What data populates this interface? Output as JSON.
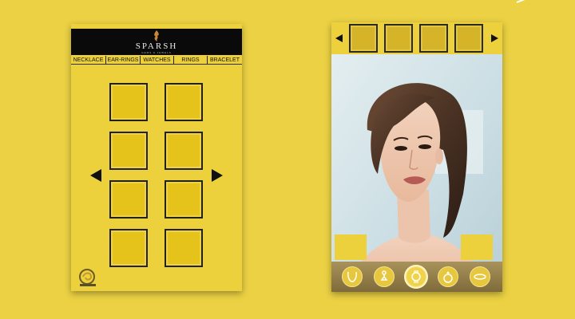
{
  "app": {
    "brand_name": "SPARSH",
    "brand_tagline": "GEMS & JEWELS",
    "brand_color": "#0a0a0a",
    "accent_color": "#ebd143"
  },
  "left_screen": {
    "categories": [
      {
        "label": "NECKLACE"
      },
      {
        "label": "EAR-RINGS"
      },
      {
        "label": "WATCHES"
      },
      {
        "label": "RINGS"
      },
      {
        "label": "BRACELET"
      }
    ],
    "grid_slot_count": 8,
    "prev_icon": "triangle-left-icon",
    "next_icon": "triangle-right-icon",
    "corner_logo_icon": "swirl-logo-icon"
  },
  "right_screen": {
    "thumbnail_count": 4,
    "prev_icon": "triangle-left-icon",
    "next_icon": "triangle-right-icon",
    "photo": "woman-portrait",
    "tools": [
      {
        "name": "necklace-icon",
        "active": false
      },
      {
        "name": "earring-icon",
        "active": false
      },
      {
        "name": "watch-icon",
        "active": true
      },
      {
        "name": "ring-icon",
        "active": false
      },
      {
        "name": "bracelet-icon",
        "active": false
      }
    ]
  }
}
